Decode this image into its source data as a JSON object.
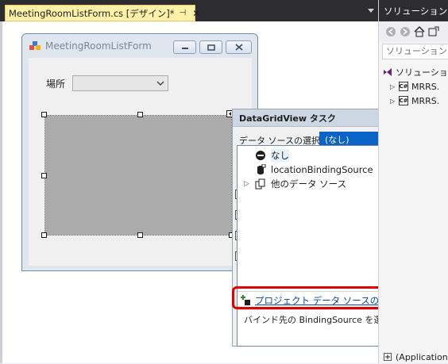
{
  "tab": {
    "title": "MeetingRoomListForm.cs [デザイン]*",
    "pin_glyph": "⊣",
    "close_glyph": "✕"
  },
  "form": {
    "title": "MeetingRoomListForm",
    "place_label": "場所",
    "place_value": ""
  },
  "task_panel": {
    "header": "DataGridView タスク",
    "datasource_label": "データ ソースの選択:",
    "datasource_value": "(なし)",
    "dropdown": {
      "items": [
        {
          "label": "なし",
          "icon": "none-icon"
        },
        {
          "label": "locationBindingSource",
          "icon": "binding-source-icon"
        },
        {
          "label": "他のデータ ソース",
          "icon": "data-sources-icon"
        }
      ],
      "add_link": "プロジェクト データ ソースの追加...",
      "description": "バインド先の BindingSource を選択してください。"
    }
  },
  "solution_explorer": {
    "title": "ソリューション エク",
    "search_placeholder": "ソリューション エク",
    "rows": [
      {
        "label": "ソリューショ"
      },
      {
        "label": "MRRS."
      },
      {
        "label": "MRRS."
      }
    ],
    "bottom_row": "(Application"
  },
  "colors": {
    "highlight": "#e00000",
    "selection_blue": "#0a64c8",
    "tab_active": "#fff1a8"
  }
}
